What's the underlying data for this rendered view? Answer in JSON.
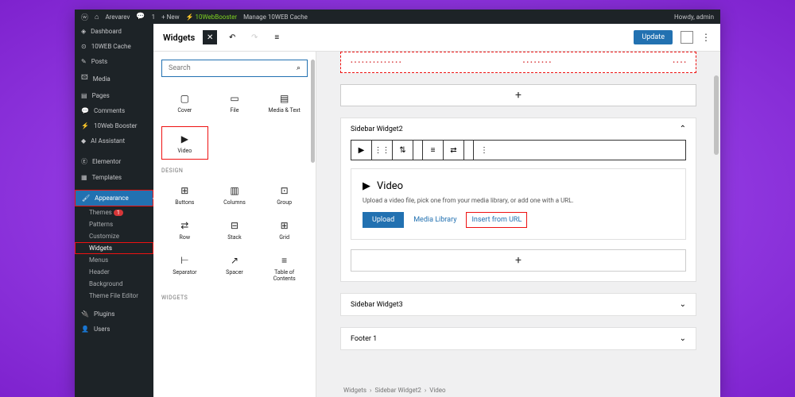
{
  "wpbar": {
    "site": "Arevarev",
    "comments": "1",
    "new": "New",
    "booster": "10WebBooster",
    "cache": "Manage 10WEB Cache",
    "howdy": "Howdy, admin"
  },
  "sidebar": {
    "items": [
      {
        "icon": "◈",
        "label": "Dashboard"
      },
      {
        "icon": "⊙",
        "label": "10WEB Cache"
      },
      {
        "icon": "✎",
        "label": "Posts"
      },
      {
        "icon": "🖾",
        "label": "Media"
      },
      {
        "icon": "▤",
        "label": "Pages"
      },
      {
        "icon": "💬",
        "label": "Comments"
      },
      {
        "icon": "⚡",
        "label": "10Web Booster"
      },
      {
        "icon": "◆",
        "label": "AI Assistant"
      },
      {
        "icon": "Ⓔ",
        "label": "Elementor"
      },
      {
        "icon": "▦",
        "label": "Templates"
      },
      {
        "icon": "🖌",
        "label": "Appearance",
        "active": true
      },
      {
        "icon": "🔌",
        "label": "Plugins"
      },
      {
        "icon": "👤",
        "label": "Users"
      }
    ],
    "subs": [
      "Themes",
      "Patterns",
      "Customize",
      "Widgets",
      "Menus",
      "Header",
      "Background",
      "Theme File Editor"
    ],
    "badge": "1"
  },
  "header": {
    "title": "Widgets",
    "update": "Update"
  },
  "search": {
    "placeholder": "Search"
  },
  "cats": {
    "design": "DESIGN",
    "widgets": "WIDGETS"
  },
  "tiles": {
    "row1": [
      {
        "i": "▢",
        "l": "Cover"
      },
      {
        "i": "▭",
        "l": "File"
      },
      {
        "i": "▤",
        "l": "Media & Text"
      }
    ],
    "video": {
      "i": "▶",
      "l": "Video"
    },
    "design": [
      {
        "i": "⊞",
        "l": "Buttons"
      },
      {
        "i": "▥",
        "l": "Columns"
      },
      {
        "i": "⊡",
        "l": "Group"
      },
      {
        "i": "⇄",
        "l": "Row"
      },
      {
        "i": "⊟",
        "l": "Stack"
      },
      {
        "i": "⊞",
        "l": "Grid"
      },
      {
        "i": "⊢",
        "l": "Separator"
      },
      {
        "i": "↗",
        "l": "Spacer"
      },
      {
        "i": "≡",
        "l": "Table of Contents"
      }
    ]
  },
  "widget2": {
    "title": "Sidebar Widget2",
    "video_title": "Video",
    "desc": "Upload a video file, pick one from your media library, or add one with a URL.",
    "upload": "Upload",
    "media": "Media Library",
    "url": "Insert from URL"
  },
  "widget3": "Sidebar Widget3",
  "footer1": "Footer 1",
  "crumbs": [
    "Widgets",
    "Sidebar Widget2",
    "Video"
  ]
}
